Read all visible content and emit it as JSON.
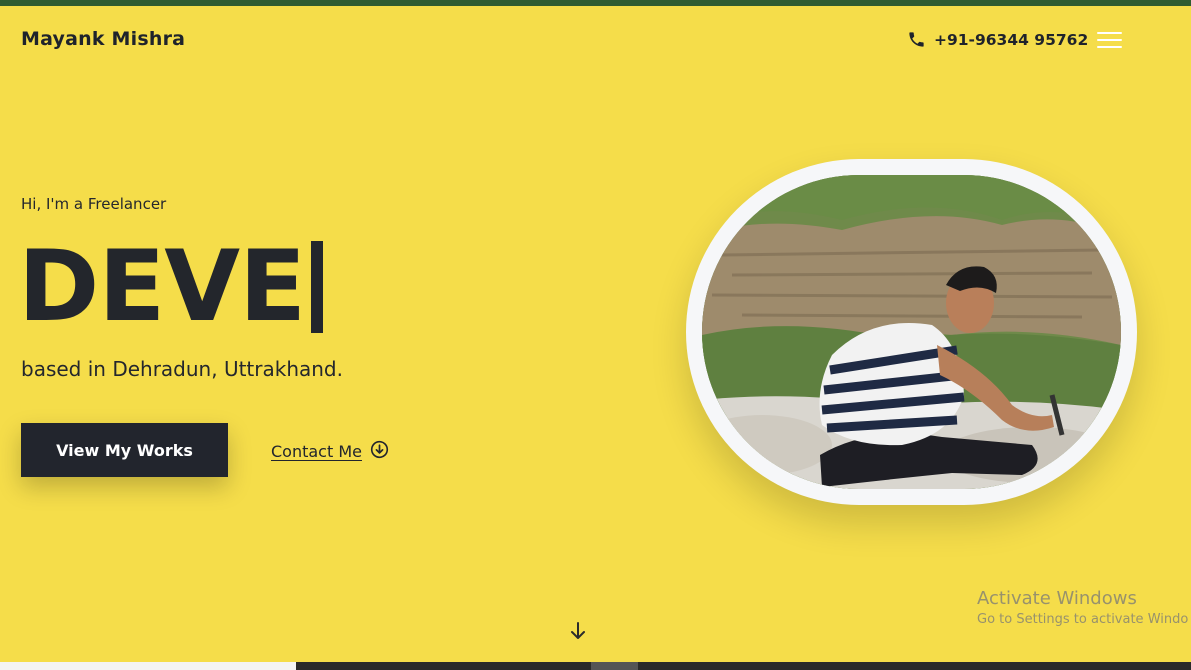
{
  "header": {
    "brand": "Mayank Mishra",
    "phone": "+91-96344 95762",
    "phone_icon": "phone-icon",
    "menu_icon": "hamburger-menu-icon"
  },
  "hero": {
    "intro": "Hi, I'm a Freelancer",
    "title": "DEVE",
    "subtitle": "based in Dehradun, Uttrakhand.",
    "primary_button": "View My Works",
    "secondary_link": "Contact Me",
    "secondary_icon": "arrow-circle-down-icon",
    "scroll_icon": "arrow-down-icon"
  },
  "watermark": {
    "title": "Activate Windows",
    "subtitle": "Go to Settings to activate Windo"
  },
  "colors": {
    "background": "#f5dd4a",
    "top_strip": "#2f5c31",
    "dark": "#22252d",
    "frame": "#f6f7f9"
  }
}
